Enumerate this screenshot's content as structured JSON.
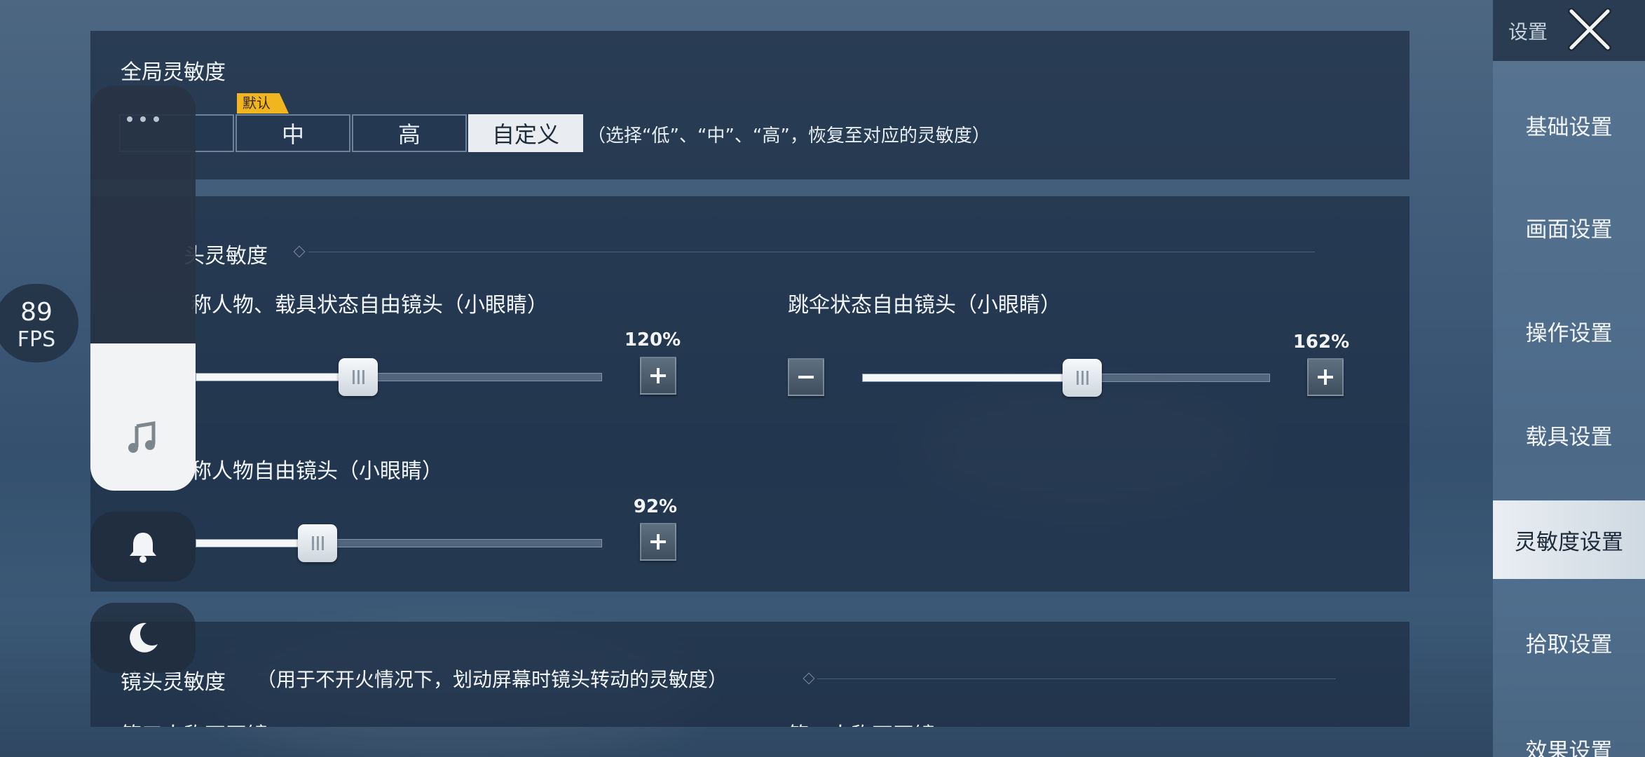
{
  "global": {
    "title": "全局灵敏度",
    "badge": "默认",
    "presets": [
      {
        "label": "",
        "active": false
      },
      {
        "label": "中",
        "active": false
      },
      {
        "label": "高",
        "active": false
      },
      {
        "label": "自定义",
        "active": true
      }
    ],
    "hint": "（选择“低”、“中”、“高”，恢复至对应的灵敏度）"
  },
  "free_camera": {
    "title": "头灵敏度",
    "sliders": [
      {
        "label": "称人物、载具状态自由镜头（小眼睛）",
        "value_text": "120%",
        "fraction": 0.4
      },
      {
        "label": "跳伞状态自由镜头（小眼睛）",
        "value_text": "162%",
        "fraction": 0.54
      },
      {
        "label": "称人物自由镜头（小眼睛）",
        "value_text": "92%",
        "fraction": 0.3
      }
    ]
  },
  "camera": {
    "title": "镜头灵敏度",
    "note": "（用于不开火情况下，划动屏幕时镜头转动的灵敏度）",
    "col_left": "第三人称不开镜",
    "col_right": "第一人称不开镜"
  },
  "nav": {
    "header": "设置",
    "items": [
      {
        "label": "基础设置",
        "active": false
      },
      {
        "label": "画面设置",
        "active": false
      },
      {
        "label": "操作设置",
        "active": false
      },
      {
        "label": "载具设置",
        "active": false
      },
      {
        "label": "灵敏度设置",
        "active": true
      },
      {
        "label": "拾取设置",
        "active": false
      },
      {
        "label": "效果设置",
        "active": false
      }
    ]
  },
  "fps": {
    "value": "89",
    "label": "FPS"
  },
  "icons": [
    "more-icon",
    "music-icon",
    "bell-icon",
    "moon-icon",
    "close-icon",
    "minus-icon",
    "plus-icon"
  ]
}
